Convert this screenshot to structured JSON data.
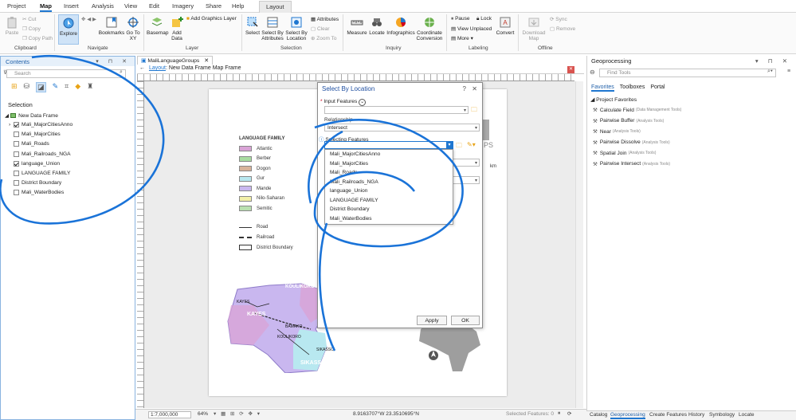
{
  "ribbon_tabs": [
    "Project",
    "Map",
    "Insert",
    "Analysis",
    "View",
    "Edit",
    "Imagery",
    "Share",
    "Help",
    "Layout"
  ],
  "active_tab": "Map",
  "clipboard": {
    "paste": "Paste",
    "cut": "Cut",
    "copy": "Copy",
    "copy_path": "Copy Path",
    "group": "Clipboard"
  },
  "navigate": {
    "explore": "Explore",
    "bookmarks": "Bookmarks",
    "goto": "Go To XY",
    "group": "Navigate"
  },
  "layer": {
    "basemap": "Basemap",
    "add_data": "Add Data",
    "add_graphics": "Add Graphics Layer",
    "group": "Layer"
  },
  "selection": {
    "select": "Select",
    "by_attr": "Select By Attributes",
    "by_loc": "Select By Location",
    "attributes": "Attributes",
    "clear": "Clear",
    "zoom_to": "Zoom To",
    "group": "Selection"
  },
  "inquiry": {
    "measure": "Measure",
    "locate": "Locate",
    "infographics": "Infographics",
    "coord": "Coordinate Conversion",
    "group": "Inquiry"
  },
  "labeling": {
    "pause": "Pause",
    "lock": "Lock",
    "view_unplaced": "View Unplaced",
    "more": "More",
    "convert": "Convert",
    "group": "Labeling"
  },
  "offline": {
    "download": "Download Map",
    "sync": "Sync",
    "remove": "Remove",
    "group": "Offline"
  },
  "contents": {
    "title": "Contents",
    "search_placeholder": "Search",
    "section": "Selection",
    "frame": "New Data Frame",
    "layers": [
      {
        "name": "Mali_MajorCitiesAnno",
        "checked": true
      },
      {
        "name": "Mali_MajorCities",
        "checked": false
      },
      {
        "name": "Mali_Roads",
        "checked": false
      },
      {
        "name": "Mali_Railroads_NGA",
        "checked": false
      },
      {
        "name": "language_Union",
        "checked": true
      },
      {
        "name": "LANGUAGE FAMILY",
        "checked": false
      },
      {
        "name": "District Boundary",
        "checked": false
      },
      {
        "name": "Mali_WaterBodies",
        "checked": false
      }
    ]
  },
  "view_tab": "MaliLanguageGroups",
  "breadcrumb": {
    "link": "Layout",
    "rest": ": New Data Frame Map Frame"
  },
  "legend": {
    "title": "LANGUAGE FAMILY",
    "items": [
      {
        "label": "Atlantic",
        "color": "#d9a3d6"
      },
      {
        "label": "Berber",
        "color": "#a8dca0"
      },
      {
        "label": "Dogon",
        "color": "#d8b39a"
      },
      {
        "label": "Gur",
        "color": "#b8e8f0"
      },
      {
        "label": "Mande",
        "color": "#c9b7ef"
      },
      {
        "label": "Nilo-Saharan",
        "color": "#f2f0a8"
      },
      {
        "label": "Semitic",
        "color": "#b9e0b0"
      }
    ],
    "lines": [
      "Road",
      "Railroad",
      "District Boundary"
    ]
  },
  "map_labels": [
    "KOULIKORO",
    "KAYES",
    "KAYES",
    "BAMAKO",
    "KOULIKORO",
    "SIKASSO",
    "SIKASSO"
  ],
  "map_partial": [
    "PS",
    "km"
  ],
  "dialog": {
    "title": "Select By Location",
    "help": "?",
    "close": "✕",
    "input_label": "Input Features",
    "relationship_label": "Relationship",
    "relationship_value": "Intersect",
    "selecting_label": "Selecting Features",
    "options": [
      "Mali_MajorCitiesAnno",
      "Mali_MajorCities",
      "Mali_Roads",
      "Mali_Railroads_NGA",
      "language_Union",
      "LANGUAGE FAMILY",
      "District Boundary",
      "Mali_WaterBodies"
    ],
    "apply": "Apply",
    "ok": "OK"
  },
  "status": {
    "scale": "1:7,000,000",
    "zoom": "64%",
    "coords": "8.9163707°W 23.3510695°N",
    "selected": "Selected Features: 0"
  },
  "geoprocessing": {
    "title": "Geoprocessing",
    "search_placeholder": "Find Tools",
    "tabs": [
      "Favorites",
      "Toolboxes",
      "Portal"
    ],
    "section": "Project Favorites",
    "tools": [
      {
        "name": "Calculate Field",
        "sub": "(Data Management Tools)"
      },
      {
        "name": "Pairwise Buffer",
        "sub": "(Analysis Tools)"
      },
      {
        "name": "Near",
        "sub": "(Analysis Tools)"
      },
      {
        "name": "Pairwise Dissolve",
        "sub": "(Analysis Tools)"
      },
      {
        "name": "Spatial Join",
        "sub": "(Analysis Tools)"
      },
      {
        "name": "Pairwise Intersect",
        "sub": "(Analysis Tools)"
      }
    ]
  },
  "bottom_tabs": [
    "Catalog",
    "Geoprocessing",
    "Create Features",
    "History",
    "Symbology",
    "Locate"
  ],
  "accent": "#1f77d0"
}
